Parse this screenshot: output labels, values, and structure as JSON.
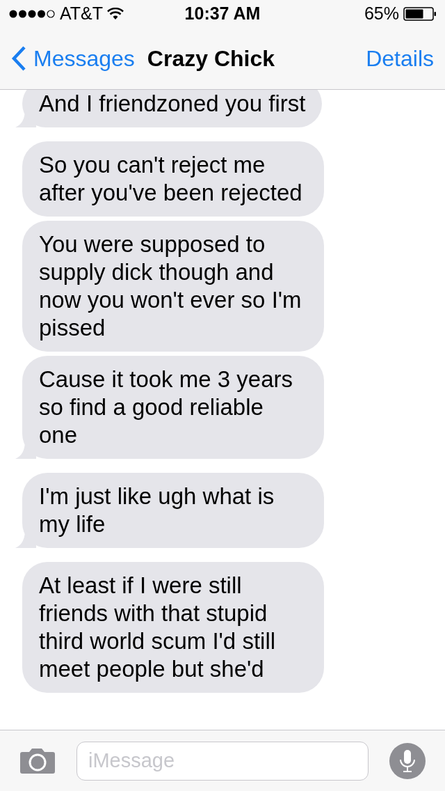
{
  "status_bar": {
    "carrier": "AT&T",
    "time": "10:37 AM",
    "battery": "65%"
  },
  "nav": {
    "back": "Messages",
    "title": "Crazy Chick",
    "action": "Details"
  },
  "messages": [
    {
      "text": "And I friendzoned you first",
      "tail": true
    },
    {
      "text": "So you can't reject me after you've been rejected",
      "tail": false
    },
    {
      "text": "You were supposed to supply dick though and now you won't ever so I'm pissed",
      "tail": false
    },
    {
      "text": "Cause it took me 3 years so find a good reliable one",
      "tail": true
    },
    {
      "text": "I'm just like ugh what is my life",
      "tail": true
    },
    {
      "text": "At least if I were still friends with that stupid third world scum I'd still meet people but she'd",
      "tail": false
    }
  ],
  "composer": {
    "placeholder": "iMessage"
  }
}
